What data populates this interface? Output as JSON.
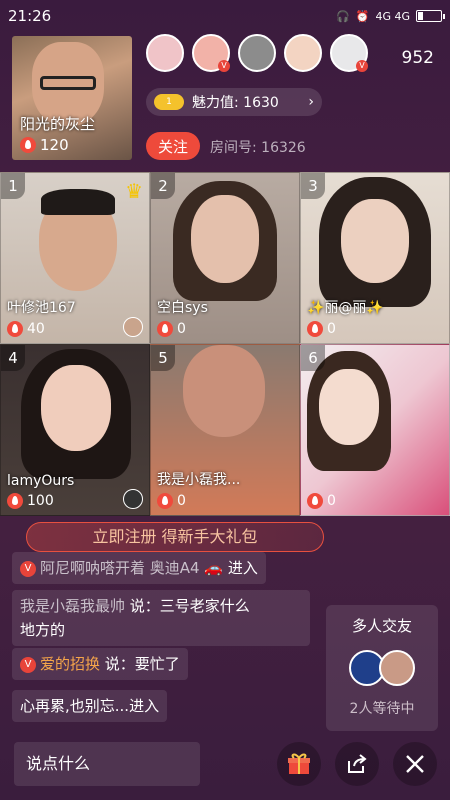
{
  "status": {
    "time": "21:26",
    "network": "4G 4G"
  },
  "host": {
    "name": "阳光的灰尘",
    "heat": "120"
  },
  "viewers": {
    "count": "952"
  },
  "charm": {
    "badge": "1",
    "label": "魅力值: 1630"
  },
  "follow_label": "关注",
  "room": "房间号: 16326",
  "tiles": [
    {
      "num": "1",
      "name": "叶修池167",
      "heat": "40"
    },
    {
      "num": "2",
      "name": "空白sys",
      "heat": "0"
    },
    {
      "num": "3",
      "name": "✨丽@丽✨",
      "heat": "0"
    },
    {
      "num": "4",
      "name": "lamyOurs",
      "heat": "100"
    },
    {
      "num": "5",
      "name": "我是小磊我...",
      "heat": "0"
    },
    {
      "num": "6",
      "name": "",
      "heat": "0"
    }
  ],
  "register_banner": "立即注册 得新手大礼包",
  "chat": [
    {
      "user": "阿尼啊呐嗒开着 奥迪A4",
      "text": "进入"
    },
    {
      "user": "我是小磊我最帅",
      "text": " 说：三号老家什么",
      "text2": "地方的"
    },
    {
      "user": "爱的招换",
      "text": " 说：要忙了"
    },
    {
      "user": "",
      "text": "心再累,也别忘...进入"
    }
  ],
  "multi": {
    "title": "多人交友",
    "waiting": "2人等待中"
  },
  "input_placeholder": "说点什么",
  "colors": {
    "accent": "#ee4a3b",
    "background": "#3a1b3e"
  }
}
